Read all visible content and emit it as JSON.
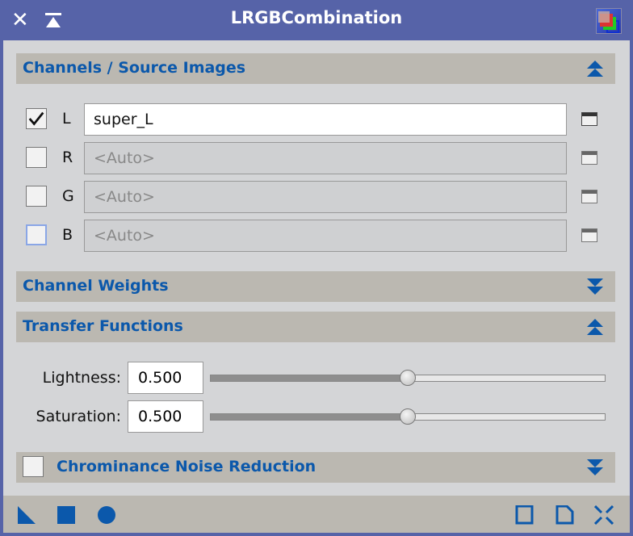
{
  "window": {
    "title": "LRGBCombination"
  },
  "sections": {
    "channels": {
      "label": "Channels / Source Images",
      "expanded": true
    },
    "weights": {
      "label": "Channel Weights",
      "expanded": false
    },
    "transfer": {
      "label": "Transfer Functions",
      "expanded": true
    },
    "chroma": {
      "label": "Chrominance Noise Reduction",
      "expanded": false,
      "checked": false
    }
  },
  "channels": [
    {
      "name": "L",
      "checked": true,
      "value": "super_L",
      "placeholder": ""
    },
    {
      "name": "R",
      "checked": false,
      "value": "",
      "placeholder": "<Auto>"
    },
    {
      "name": "G",
      "checked": false,
      "value": "",
      "placeholder": "<Auto>"
    },
    {
      "name": "B",
      "checked": false,
      "value": "",
      "placeholder": "<Auto>"
    }
  ],
  "transfer": {
    "lightness": {
      "label": "Lightness:",
      "value": "0.500",
      "fraction": 0.5
    },
    "saturation": {
      "label": "Saturation:",
      "value": "0.500",
      "fraction": 0.5
    }
  },
  "colors": {
    "accent": "#0b58ab",
    "titlebar": "#5663a8",
    "section": "#bbb8b1"
  }
}
